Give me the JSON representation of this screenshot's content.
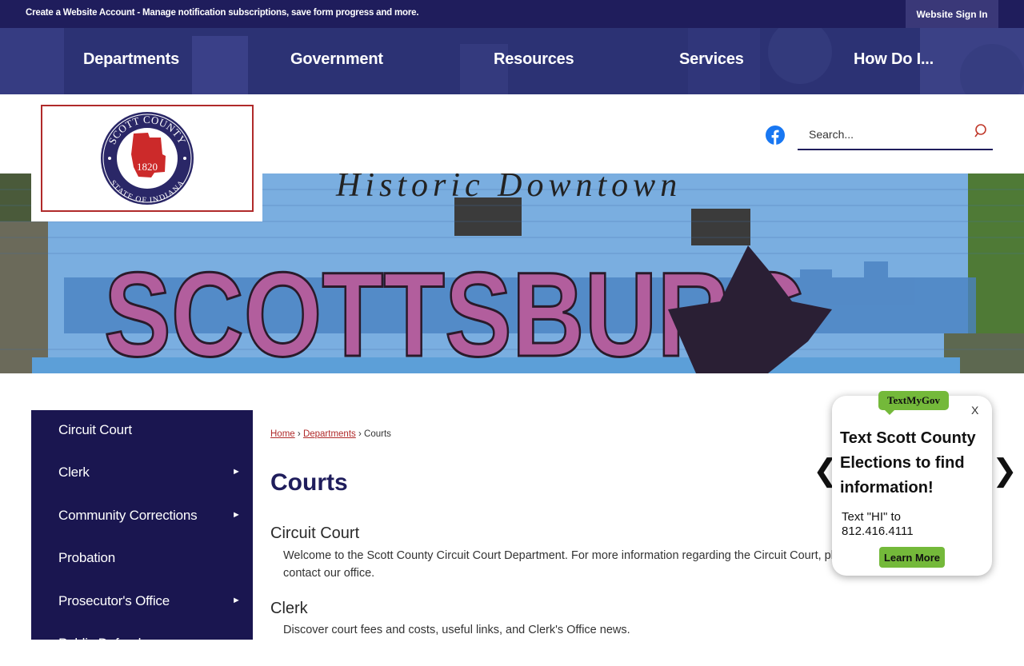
{
  "topbar": {
    "message": "Create a Website Account - Manage notification subscriptions, save form progress and more.",
    "signin_label": "Website Sign In"
  },
  "nav": {
    "items": [
      "Departments",
      "Government",
      "Resources",
      "Services",
      "How Do I..."
    ]
  },
  "logo": {
    "name_arc": "SCOTT COUNTY",
    "year": "1820",
    "state_arc": "STATE OF INDIANA"
  },
  "header": {
    "facebook_icon": "facebook-icon",
    "search_placeholder": "Search...",
    "search_icon": "search-icon"
  },
  "hero": {
    "mural_script": "Historic Downtown",
    "mural_text": "SCOTTSBURG"
  },
  "sidebar": {
    "items": [
      {
        "label": "Circuit Court",
        "has_submenu": false
      },
      {
        "label": "Clerk",
        "has_submenu": true
      },
      {
        "label": "Community Corrections",
        "has_submenu": true
      },
      {
        "label": "Probation",
        "has_submenu": false
      },
      {
        "label": "Prosecutor's Office",
        "has_submenu": true
      },
      {
        "label": "Public Defender",
        "has_submenu": false
      }
    ],
    "arrow_glyph": "►"
  },
  "breadcrumb": {
    "home": "Home",
    "departments": "Departments",
    "current": "Courts",
    "separator": "›"
  },
  "main": {
    "title": "Courts",
    "sections": [
      {
        "title": "Circuit Court",
        "text": "Welcome to the Scott County Circuit Court Department. For more information regarding the Circuit Court, please contact our office."
      },
      {
        "title": "Clerk",
        "text": "Discover court fees and costs, useful links, and Clerk's Office news."
      }
    ]
  },
  "popup": {
    "brand": "TextMyGov",
    "close_label": "X",
    "heading": "Text Scott County Elections to find information!",
    "text": "Text \"HI\" to 812.416.4111",
    "learn_more": "Learn More",
    "prev_glyph": "❮",
    "next_glyph": "❯"
  },
  "colors": {
    "navy": "#1f1d5c",
    "sidebar": "#1a1650",
    "accent_red": "#b02a2a",
    "green": "#74b93a"
  }
}
